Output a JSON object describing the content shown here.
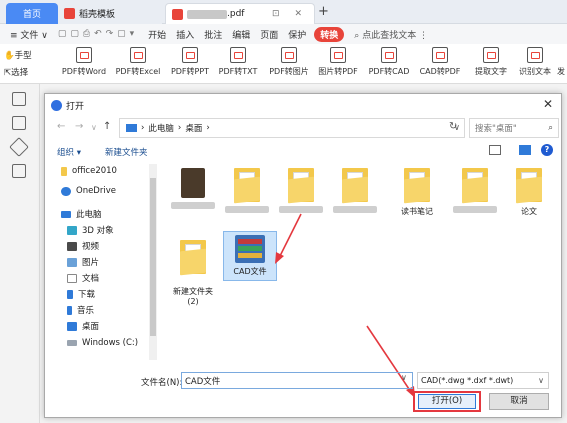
{
  "tabs": {
    "home": "首页",
    "template": "稻壳模板",
    "pdf_suffix": ".pdf",
    "pdf_icons": "⊡ ✕",
    "new_tab": "+"
  },
  "menu": {
    "file": "≡ 文件 ∨",
    "items": [
      "开始",
      "插入",
      "批注",
      "编辑",
      "页面",
      "保护"
    ],
    "convert": "转换",
    "search": "点此查找文本 ⋮"
  },
  "ribbon": {
    "hand_tool": "手型",
    "select_tool": "选择",
    "items": [
      "PDF转Word",
      "PDF转Excel",
      "PDF转PPT",
      "PDF转TXT",
      "PDF转图片",
      "图片转PDF",
      "PDF转CAD",
      "CAD转PDF",
      "提取文字",
      "识别文本",
      "发"
    ]
  },
  "dialog": {
    "title": "打开",
    "close": "✕",
    "nav": {
      "back": "←",
      "forward": "→",
      "down": "∨",
      "up": "↑"
    },
    "address": {
      "pc": "此电脑",
      "sep": "›",
      "desktop": "桌面",
      "tail_sep": "›",
      "dropdown": "∨"
    },
    "refresh": "↻",
    "search_placeholder": "搜索\"桌面\"",
    "search_icon": "⌕",
    "organize": "组织 ▾",
    "new_folder": "新建文件夹",
    "help": "?",
    "nav_pane": [
      {
        "label": "office2010",
        "icon": "folder-icon"
      },
      {
        "label": "OneDrive",
        "icon": "cloud-icon"
      },
      {
        "label": "此电脑",
        "icon": "computer-icon"
      },
      {
        "label": "3D 对象",
        "icon": "cube-icon"
      },
      {
        "label": "视频",
        "icon": "video-icon"
      },
      {
        "label": "图片",
        "icon": "picture-icon"
      },
      {
        "label": "文档",
        "icon": "document-icon"
      },
      {
        "label": "下载",
        "icon": "download-icon"
      },
      {
        "label": "音乐",
        "icon": "music-icon"
      },
      {
        "label": "桌面",
        "icon": "desktop-icon"
      },
      {
        "label": "Windows (C:)",
        "icon": "drive-icon"
      }
    ],
    "files": [
      {
        "label": "",
        "blurred": true
      },
      {
        "label": "",
        "blurred": true
      },
      {
        "label": "",
        "blurred": true
      },
      {
        "label": "",
        "blurred": true
      },
      {
        "label": "读书笔记",
        "blurred": false
      },
      {
        "label": "",
        "blurred": true
      },
      {
        "label": "论文",
        "blurred": false
      }
    ],
    "new_folder_2": "新建文件夹\n(2)",
    "cad_file": "CAD文件",
    "filename_label": "文件名(N):",
    "filename_value": "CAD文件",
    "filetype": "CAD(*.dwg *.dxf *.dwt)",
    "open_button": "打开(O)",
    "cancel_button": "取消"
  },
  "colors": {
    "accent": "#e8443a",
    "highlight": "#e4383f",
    "tab_home": "#4a8af4",
    "selection": "#cce4fb"
  }
}
